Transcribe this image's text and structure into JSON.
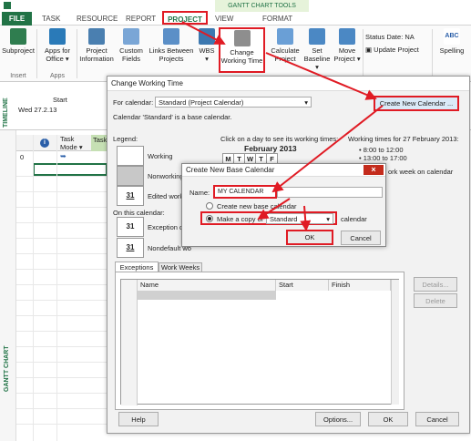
{
  "ribbon_tabs": {
    "file": "FILE",
    "task": "TASK",
    "resource": "RESOURCE",
    "report": "REPORT",
    "project": "PROJECT",
    "view": "VIEW",
    "format": "FORMAT",
    "context_header": "GANTT CHART TOOLS"
  },
  "ribbon": {
    "subproject": "Subproject",
    "apps_for_office": "Apps for Office ▾",
    "project_information": "Project Information",
    "custom_fields": "Custom Fields",
    "links_between": "Links Between Projects",
    "wbs": "WBS ▾",
    "change_working_time": "Change Working Time",
    "calculate_project": "Calculate Project",
    "set_baseline": "Set Baseline ▾",
    "move_project": "Move Project ▾",
    "status_date_label": "Status Date:",
    "status_date_value": "NA",
    "update_project": "Update Project",
    "spelling": "Spelling",
    "group_insert": "Insert",
    "group_apps": "Apps"
  },
  "timeline": {
    "label": "TIMELINE",
    "start_label": "Start",
    "start_value": "Wed 27.2.13"
  },
  "grid": {
    "row_number": "0",
    "col_task_mode": "Task Mode ▾",
    "col_task": "Task",
    "side_label": "GANTT CHART"
  },
  "cwt": {
    "title": "Change Working Time",
    "for_calendar_label": "For calendar:",
    "for_calendar_value": "Standard (Project Calendar)",
    "base_note": "Calendar 'Standard' is a base calendar.",
    "create_new_calendar": "Create New Calendar ...",
    "legend_label": "Legend:",
    "working": "Working",
    "nonworking": "Nonworking",
    "edited_working": "Edited working",
    "on_this_calendar": "On this calendar:",
    "exception_day": "Exception day",
    "nondefault": "Nondefault wo",
    "legend_num": "31",
    "click_day": "Click on a day to see its working times:",
    "working_times_for": "Working times for 27 February 2013:",
    "month": "February 2013",
    "days": [
      "M",
      "T",
      "W",
      "T",
      "F"
    ],
    "times": [
      "• 8:00 to 12:00",
      "• 13:00 to 17:00"
    ],
    "work_week_note": "ork week on calendar",
    "tab_exceptions": "Exceptions",
    "tab_work_weeks": "Work Weeks",
    "col_name": "Name",
    "col_start": "Start",
    "col_finish": "Finish",
    "details": "Details...",
    "delete": "Delete",
    "help": "Help",
    "options": "Options...",
    "ok": "OK",
    "cancel": "Cancel"
  },
  "cnbc": {
    "title": "Create New Base Calendar",
    "name_label": "Name:",
    "name_value": "MY CALENDAR",
    "create_new": "Create new base calendar",
    "make_copy": "Make a copy of",
    "copy_value": "Standard",
    "calendar_suffix": "calendar",
    "ok": "OK",
    "cancel": "Cancel"
  },
  "colors": {
    "accent": "#217346",
    "highlight": "#e01b24"
  }
}
